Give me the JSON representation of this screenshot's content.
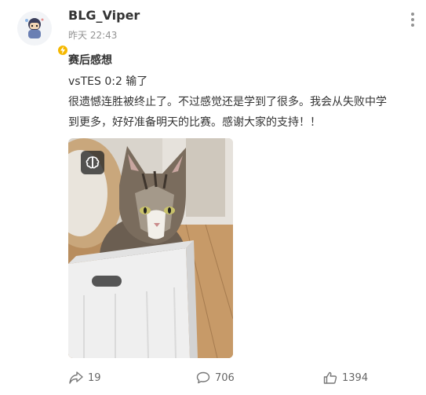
{
  "post": {
    "username": "BLG_Viper",
    "time": "昨天 22:43",
    "title": "赛后感想",
    "lines": [
      "vsTES 0:2 输了",
      "很遗憾连胜被终止了。不过感觉还是学到了很多。我会从失败中学",
      "到更多，好好准备明天的比赛。感谢大家的支持！！"
    ],
    "image": {
      "subject": "cat-in-box-photo",
      "overlay_icon": "brain-icon"
    }
  },
  "actions": {
    "share": {
      "icon": "share-icon",
      "count": "19"
    },
    "comment": {
      "icon": "comment-icon",
      "count": "706"
    },
    "like": {
      "icon": "thumbs-up-icon",
      "count": "1394"
    }
  },
  "badge": {
    "icon": "lightning-icon",
    "color": "#f5b800"
  }
}
